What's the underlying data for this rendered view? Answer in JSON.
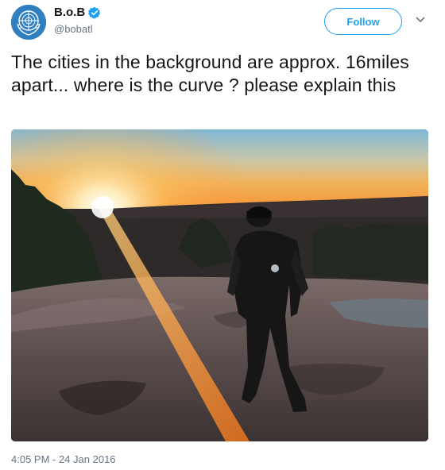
{
  "tweet": {
    "author": {
      "display_name": "B.o.B",
      "handle": "@bobatl",
      "verified": true,
      "avatar_icon": "un-emblem-icon"
    },
    "follow_label": "Follow",
    "menu_icon": "chevron-down-icon",
    "text": "The cities in the background are approx. 16miles apart... where is the curve ? please explain this",
    "media": {
      "type": "photo",
      "description_icon": "sunset-photo"
    },
    "timestamp": "4:05 PM - 24 Jan 2016"
  },
  "colors": {
    "accent": "#1da1f2",
    "text": "#14171a",
    "muted": "#657786"
  }
}
